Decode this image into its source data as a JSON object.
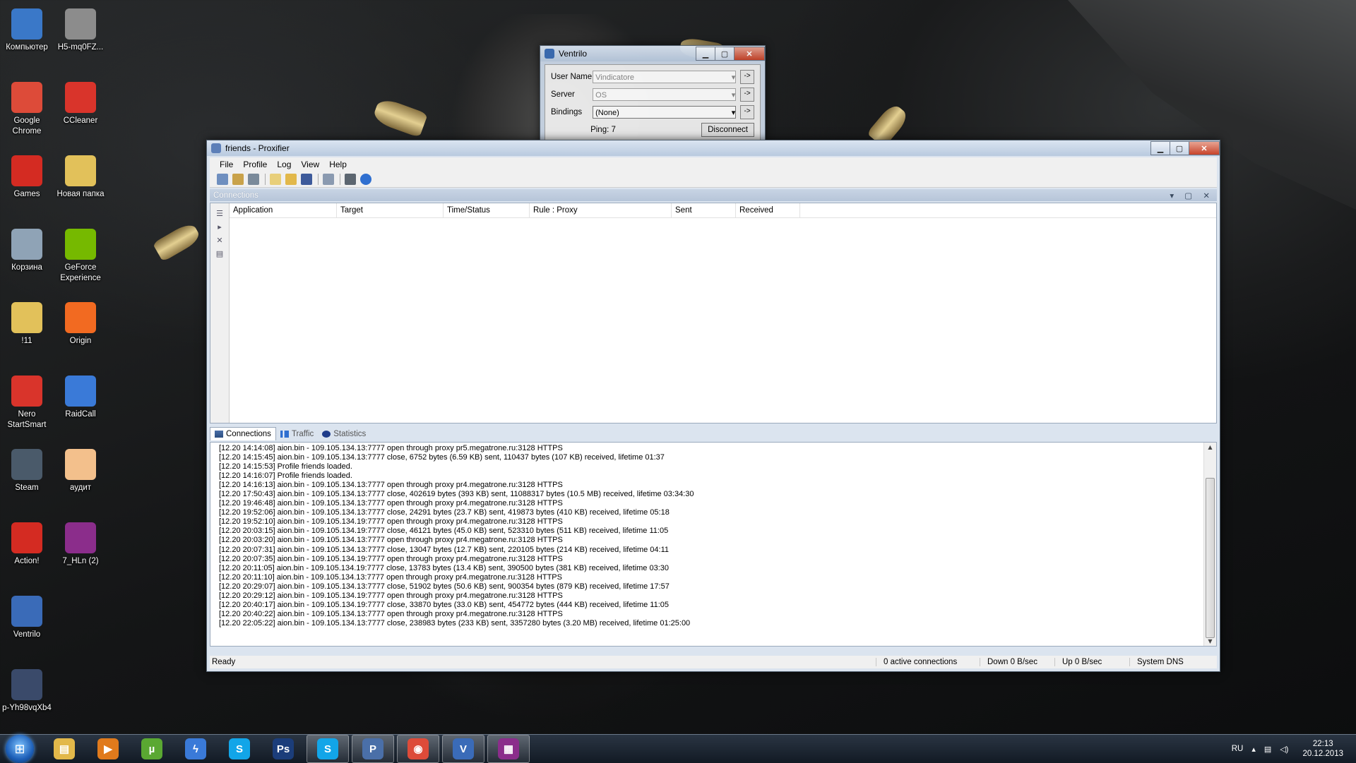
{
  "desktop": {
    "icons": [
      {
        "label": "Компьютер",
        "icon": "computer-icon",
        "color": "#3a78c8"
      },
      {
        "label": "H5-mq0FZ...",
        "icon": "image-file-icon",
        "color": "#8c8c8c"
      },
      {
        "label": "Google Chrome",
        "icon": "chrome-icon",
        "color": "#dd4b39"
      },
      {
        "label": "CCleaner",
        "icon": "ccleaner-icon",
        "color": "#d9342b"
      },
      {
        "label": "Games",
        "icon": "games-icon",
        "color": "#d42b22"
      },
      {
        "label": "Новая папка",
        "icon": "folder-icon",
        "color": "#e2c15a"
      },
      {
        "label": "Корзина",
        "icon": "recycle-bin-icon",
        "color": "#8fa3b6"
      },
      {
        "label": "GeForce Experience",
        "icon": "geforce-icon",
        "color": "#76b900"
      },
      {
        "label": "!11",
        "icon": "folder-icon",
        "color": "#e2c15a"
      },
      {
        "label": "Origin",
        "icon": "origin-icon",
        "color": "#f26a21"
      },
      {
        "label": "Nero StartSmart",
        "icon": "nero-icon",
        "color": "#d9342b"
      },
      {
        "label": "RaidCall",
        "icon": "raidcall-icon",
        "color": "#3a7ad8"
      },
      {
        "label": "Steam",
        "icon": "steam-icon",
        "color": "#4a5a6a"
      },
      {
        "label": "аудит",
        "icon": "document-icon",
        "color": "#f3c08c"
      },
      {
        "label": "Action!",
        "icon": "action-icon",
        "color": "#d42b22"
      },
      {
        "label": "7_HLn (2)",
        "icon": "winrar-icon",
        "color": "#8b2d8b"
      },
      {
        "label": "Ventrilo",
        "icon": "ventrilo-icon",
        "color": "#3a6bb8"
      },
      {
        "label": "p-Yh98vqXb4",
        "icon": "image-file-icon",
        "color": "#3a4a6a"
      }
    ]
  },
  "ventrilo": {
    "title": "Ventrilo",
    "username_label": "User Name",
    "username_value": "Vindicatore",
    "server_label": "Server",
    "server_value": "OS",
    "bindings_label": "Bindings",
    "bindings_value": "(None)",
    "ping": "Ping: 7",
    "disconnect": "Disconnect",
    "go": "->"
  },
  "proxifier": {
    "title": "friends - Proxifier",
    "menu": [
      "File",
      "Profile",
      "Log",
      "View",
      "Help"
    ],
    "panel_title": "Connections",
    "columns": [
      "Application",
      "Target",
      "Time/Status",
      "Rule : Proxy",
      "Sent",
      "Received"
    ],
    "tabs": [
      {
        "label": "Connections",
        "active": true,
        "icon": "connections-icon"
      },
      {
        "label": "Traffic",
        "active": false,
        "icon": "traffic-icon"
      },
      {
        "label": "Statistics",
        "active": false,
        "icon": "statistics-icon"
      }
    ],
    "log": [
      "[12.20 14:14:08] aion.bin - 109.105.134.13:7777 open through proxy pr5.megatrone.ru:3128 HTTPS",
      "[12.20 14:15:45] aion.bin - 109.105.134.13:7777 close, 6752 bytes (6.59 KB) sent, 110437 bytes (107 KB) received, lifetime 01:37",
      "[12.20 14:15:53] Profile friends loaded.",
      "[12.20 14:16:07] Profile friends loaded.",
      "[12.20 14:16:13] aion.bin - 109.105.134.13:7777 open through proxy pr4.megatrone.ru:3128 HTTPS",
      "[12.20 17:50:43] aion.bin - 109.105.134.13:7777 close, 402619 bytes (393 KB) sent, 11088317 bytes (10.5 MB) received, lifetime 03:34:30",
      "[12.20 19:46:48] aion.bin - 109.105.134.13:7777 open through proxy pr4.megatrone.ru:3128 HTTPS",
      "[12.20 19:52:06] aion.bin - 109.105.134.13:7777 close, 24291 bytes (23.7 KB) sent, 419873 bytes (410 KB) received, lifetime 05:18",
      "[12.20 19:52:10] aion.bin - 109.105.134.19:7777 open through proxy pr4.megatrone.ru:3128 HTTPS",
      "[12.20 20:03:15] aion.bin - 109.105.134.19:7777 close, 46121 bytes (45.0 KB) sent, 523310 bytes (511 KB) received, lifetime 11:05",
      "[12.20 20:03:20] aion.bin - 109.105.134.13:7777 open through proxy pr4.megatrone.ru:3128 HTTPS",
      "[12.20 20:07:31] aion.bin - 109.105.134.13:7777 close, 13047 bytes (12.7 KB) sent, 220105 bytes (214 KB) received, lifetime 04:11",
      "[12.20 20:07:35] aion.bin - 109.105.134.19:7777 open through proxy pr4.megatrone.ru:3128 HTTPS",
      "[12.20 20:11:05] aion.bin - 109.105.134.19:7777 close, 13783 bytes (13.4 KB) sent, 390500 bytes (381 KB) received, lifetime 03:30",
      "[12.20 20:11:10] aion.bin - 109.105.134.13:7777 open through proxy pr4.megatrone.ru:3128 HTTPS",
      "[12.20 20:29:07] aion.bin - 109.105.134.13:7777 close, 51902 bytes (50.6 KB) sent, 900354 bytes (879 KB) received, lifetime 17:57",
      "[12.20 20:29:12] aion.bin - 109.105.134.19:7777 open through proxy pr4.megatrone.ru:3128 HTTPS",
      "[12.20 20:40:17] aion.bin - 109.105.134.19:7777 close, 33870 bytes (33.0 KB) sent, 454772 bytes (444 KB) received, lifetime 11:05",
      "[12.20 20:40:22] aion.bin - 109.105.134.13:7777 open through proxy pr4.megatrone.ru:3128 HTTPS",
      "[12.20 22:05:22] aion.bin - 109.105.134.13:7777 close, 238983 bytes (233 KB) sent, 3357280 bytes (3.20 MB) received, lifetime 01:25:00"
    ],
    "status": {
      "ready": "Ready",
      "active": "0 active connections",
      "down": "Down 0 B/sec",
      "up": "Up 0 B/sec",
      "dns": "System DNS"
    }
  },
  "taskbar": {
    "apps": [
      {
        "icon": "explorer-icon",
        "color": "#e2b84a",
        "glyph": "▤",
        "open": false
      },
      {
        "icon": "media-player-icon",
        "color": "#e07a1c",
        "glyph": "▶",
        "open": false
      },
      {
        "icon": "utorrent-icon",
        "color": "#5aa832",
        "glyph": "µ",
        "open": false
      },
      {
        "icon": "thunder-icon",
        "color": "#3a7ad8",
        "glyph": "ϟ",
        "open": false
      },
      {
        "icon": "skype-icon",
        "color": "#12a5e8",
        "glyph": "S",
        "open": false
      },
      {
        "icon": "photoshop-icon",
        "color": "#1b3d7a",
        "glyph": "Ps",
        "open": false
      },
      {
        "icon": "skype-icon",
        "color": "#12a5e8",
        "glyph": "S",
        "open": true
      },
      {
        "icon": "proxifier-icon",
        "color": "#4a6fa8",
        "glyph": "P",
        "open": true
      },
      {
        "icon": "chrome-icon",
        "color": "#dd4b39",
        "glyph": "◉",
        "open": true
      },
      {
        "icon": "ventrilo-icon",
        "color": "#3a6bb8",
        "glyph": "V",
        "open": true
      },
      {
        "icon": "winrar-icon",
        "color": "#8b2d8b",
        "glyph": "▦",
        "open": true
      }
    ],
    "lang": "RU",
    "time": "22:13",
    "date": "20.12.2013"
  }
}
